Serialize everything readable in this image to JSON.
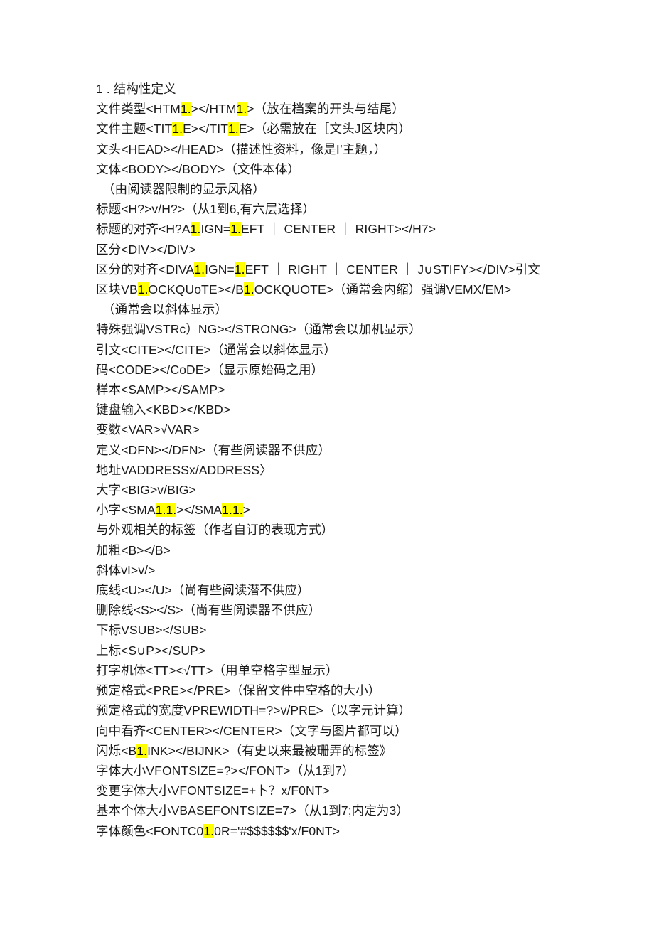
{
  "document": {
    "page_background": "#ffffff",
    "text_color": "#1a1a1a",
    "highlight_color": "#ffff00",
    "heading": "1 . 结构性定义",
    "lines": [
      {
        "id": "line-heading",
        "indent": false,
        "segments": [
          {
            "text": "1 . 结构性定义",
            "highlight": false
          }
        ]
      },
      {
        "id": "line-doctype",
        "indent": false,
        "segments": [
          {
            "text": "文件类型<HTM",
            "highlight": false
          },
          {
            "text": "1.",
            "highlight": true
          },
          {
            "text": "></HTM",
            "highlight": false
          },
          {
            "text": "1.",
            "highlight": true
          },
          {
            "text": ">（放在档案的开头与结尾）",
            "highlight": false
          }
        ]
      },
      {
        "id": "line-title",
        "indent": false,
        "segments": [
          {
            "text": "文件主题<TIT",
            "highlight": false
          },
          {
            "text": "1.",
            "highlight": true
          },
          {
            "text": "E></TIT",
            "highlight": false
          },
          {
            "text": "1.",
            "highlight": true
          },
          {
            "text": "E>（必需放在［文头J区块内）",
            "highlight": false
          }
        ]
      },
      {
        "id": "line-head",
        "indent": false,
        "segments": [
          {
            "text": "文头<HEAD></HEAD>（描述性资料，像是I’主题，）",
            "highlight": false
          }
        ]
      },
      {
        "id": "line-body",
        "indent": false,
        "segments": [
          {
            "text": "文体<BODY></BODY>（文件本体）",
            "highlight": false
          }
        ]
      },
      {
        "id": "line-reader-style",
        "indent": true,
        "segments": [
          {
            "text": "（由阅读器限制的显示风格）",
            "highlight": false
          }
        ]
      },
      {
        "id": "line-heading-tag",
        "indent": false,
        "segments": [
          {
            "text": "标题<H?>v/H?>（从1到6,有六层选择）",
            "highlight": false
          }
        ]
      },
      {
        "id": "line-heading-align",
        "indent": false,
        "segments": [
          {
            "text": "标题的对齐<H?A",
            "highlight": false
          },
          {
            "text": "1.",
            "highlight": true
          },
          {
            "text": "IGN=",
            "highlight": false
          },
          {
            "text": "1.",
            "highlight": true
          },
          {
            "text": "EFT ｜ CENTER ｜ RIGHT></H7>",
            "highlight": false
          }
        ]
      },
      {
        "id": "line-div",
        "indent": false,
        "segments": [
          {
            "text": "区分<DIV></DIV>",
            "highlight": false
          }
        ]
      },
      {
        "id": "line-div-align",
        "indent": false,
        "segments": [
          {
            "text": "区分的对齐<DIVA",
            "highlight": false
          },
          {
            "text": "1.",
            "highlight": true
          },
          {
            "text": "IGN=",
            "highlight": false
          },
          {
            "text": "1.",
            "highlight": true
          },
          {
            "text": "EFT ｜ RIGHT ｜ CENTER ｜ J∪STIFY></DIV>引文",
            "highlight": false
          }
        ]
      },
      {
        "id": "line-blockquote",
        "indent": false,
        "segments": [
          {
            "text": "区块VB",
            "highlight": false
          },
          {
            "text": "1.",
            "highlight": true
          },
          {
            "text": "OCKQUoTE></B",
            "highlight": false
          },
          {
            "text": "1.",
            "highlight": true
          },
          {
            "text": "OCKQUOTE>（通常会内缩）强调VEMX/EM>",
            "highlight": false
          }
        ]
      },
      {
        "id": "line-italic-note",
        "indent": true,
        "segments": [
          {
            "text": "（通常会以斜体显示）",
            "highlight": false
          }
        ]
      },
      {
        "id": "line-strong",
        "indent": false,
        "segments": [
          {
            "text": "特殊强调VSTRc）NG></STRONG>（通常会以加机显示）",
            "highlight": false
          }
        ]
      },
      {
        "id": "line-cite",
        "indent": false,
        "segments": [
          {
            "text": "引文<CITE></CITE>（通常会以斜体显示）",
            "highlight": false
          }
        ]
      },
      {
        "id": "line-code",
        "indent": false,
        "segments": [
          {
            "text": "码<CODE></CoDE>（显示原始码之用）",
            "highlight": false
          }
        ]
      },
      {
        "id": "line-samp",
        "indent": false,
        "segments": [
          {
            "text": "样本<SAMP></SAMP>",
            "highlight": false
          }
        ]
      },
      {
        "id": "line-kbd",
        "indent": false,
        "segments": [
          {
            "text": "键盘输入<KBD></KBD>",
            "highlight": false
          }
        ]
      },
      {
        "id": "line-var",
        "indent": false,
        "segments": [
          {
            "text": "变数<VAR>√VAR>",
            "highlight": false
          }
        ]
      },
      {
        "id": "line-dfn",
        "indent": false,
        "segments": [
          {
            "text": "定义<DFN></DFN>（有些阅读器不供应）",
            "highlight": false
          }
        ]
      },
      {
        "id": "line-address",
        "indent": false,
        "segments": [
          {
            "text": "地址VADDRESSx/ADDRESS〉",
            "highlight": false
          }
        ]
      },
      {
        "id": "line-big",
        "indent": false,
        "segments": [
          {
            "text": "大字<BIG>v/BIG>",
            "highlight": false
          }
        ]
      },
      {
        "id": "line-small",
        "indent": false,
        "segments": [
          {
            "text": "小字<SMA",
            "highlight": false
          },
          {
            "text": "1.1.",
            "highlight": true
          },
          {
            "text": "></SMA",
            "highlight": false
          },
          {
            "text": "1.1.",
            "highlight": true
          },
          {
            "text": ">",
            "highlight": false
          }
        ]
      },
      {
        "id": "line-appearance-tags",
        "indent": false,
        "segments": [
          {
            "text": "与外观相关的标签（作者自订的表现方式）",
            "highlight": false
          }
        ]
      },
      {
        "id": "line-bold",
        "indent": false,
        "segments": [
          {
            "text": "加粗<B></B>",
            "highlight": false
          }
        ]
      },
      {
        "id": "line-italic",
        "indent": false,
        "segments": [
          {
            "text": "斜体vI>v/>",
            "highlight": false
          }
        ]
      },
      {
        "id": "line-underline",
        "indent": false,
        "segments": [
          {
            "text": "底线<U></U>（尚有些阅读潜不供应）",
            "highlight": false
          }
        ]
      },
      {
        "id": "line-strike",
        "indent": false,
        "segments": [
          {
            "text": "删除线<S></S>（尚有些阅读器不供应）",
            "highlight": false
          }
        ]
      },
      {
        "id": "line-sub",
        "indent": false,
        "segments": [
          {
            "text": "下标VSUB></SUB>",
            "highlight": false
          }
        ]
      },
      {
        "id": "line-sup",
        "indent": false,
        "segments": [
          {
            "text": "上标<S∪P></SUP>",
            "highlight": false
          }
        ]
      },
      {
        "id": "line-tt",
        "indent": false,
        "segments": [
          {
            "text": "打字机体<TT><√TT>（用单空格字型显示）",
            "highlight": false
          }
        ]
      },
      {
        "id": "line-pre",
        "indent": false,
        "segments": [
          {
            "text": "预定格式<PRE></PRE>（保留文件中空格的大小）",
            "highlight": false
          }
        ]
      },
      {
        "id": "line-pre-width",
        "indent": false,
        "segments": [
          {
            "text": "预定格式的宽度VPREWIDTH=?>v/PRE>（以字元计算）",
            "highlight": false
          }
        ]
      },
      {
        "id": "line-center",
        "indent": false,
        "segments": [
          {
            "text": "向中看齐<CENTER></CENTER>（文字与图片都可以）",
            "highlight": false
          }
        ]
      },
      {
        "id": "line-blink",
        "indent": false,
        "segments": [
          {
            "text": "闪烁<B",
            "highlight": false
          },
          {
            "text": "1.",
            "highlight": true
          },
          {
            "text": "INK></BIJNK>（有史以来最被珊弄的标签》",
            "highlight": false
          }
        ]
      },
      {
        "id": "line-fontsize",
        "indent": false,
        "segments": [
          {
            "text": "字体大小VFONTSIZE=?></FONT>（从1到7）",
            "highlight": false
          }
        ]
      },
      {
        "id": "line-fontsize-change",
        "indent": false,
        "segments": [
          {
            "text": "变更字体大小VFONTSIZE=+卜？x/F0NT>",
            "highlight": false
          }
        ]
      },
      {
        "id": "line-basefont",
        "indent": false,
        "segments": [
          {
            "text": "基本个体大小VBASEFONTSIZE=7>（从1到7;内定为3）",
            "highlight": false
          }
        ]
      },
      {
        "id": "line-fontcolor",
        "indent": false,
        "segments": [
          {
            "text": "字体颜色<FONTC0",
            "highlight": false
          },
          {
            "text": "1.",
            "highlight": true
          },
          {
            "text": "0R='#$$$$$$'x/F0NT>",
            "highlight": false
          }
        ]
      }
    ]
  }
}
